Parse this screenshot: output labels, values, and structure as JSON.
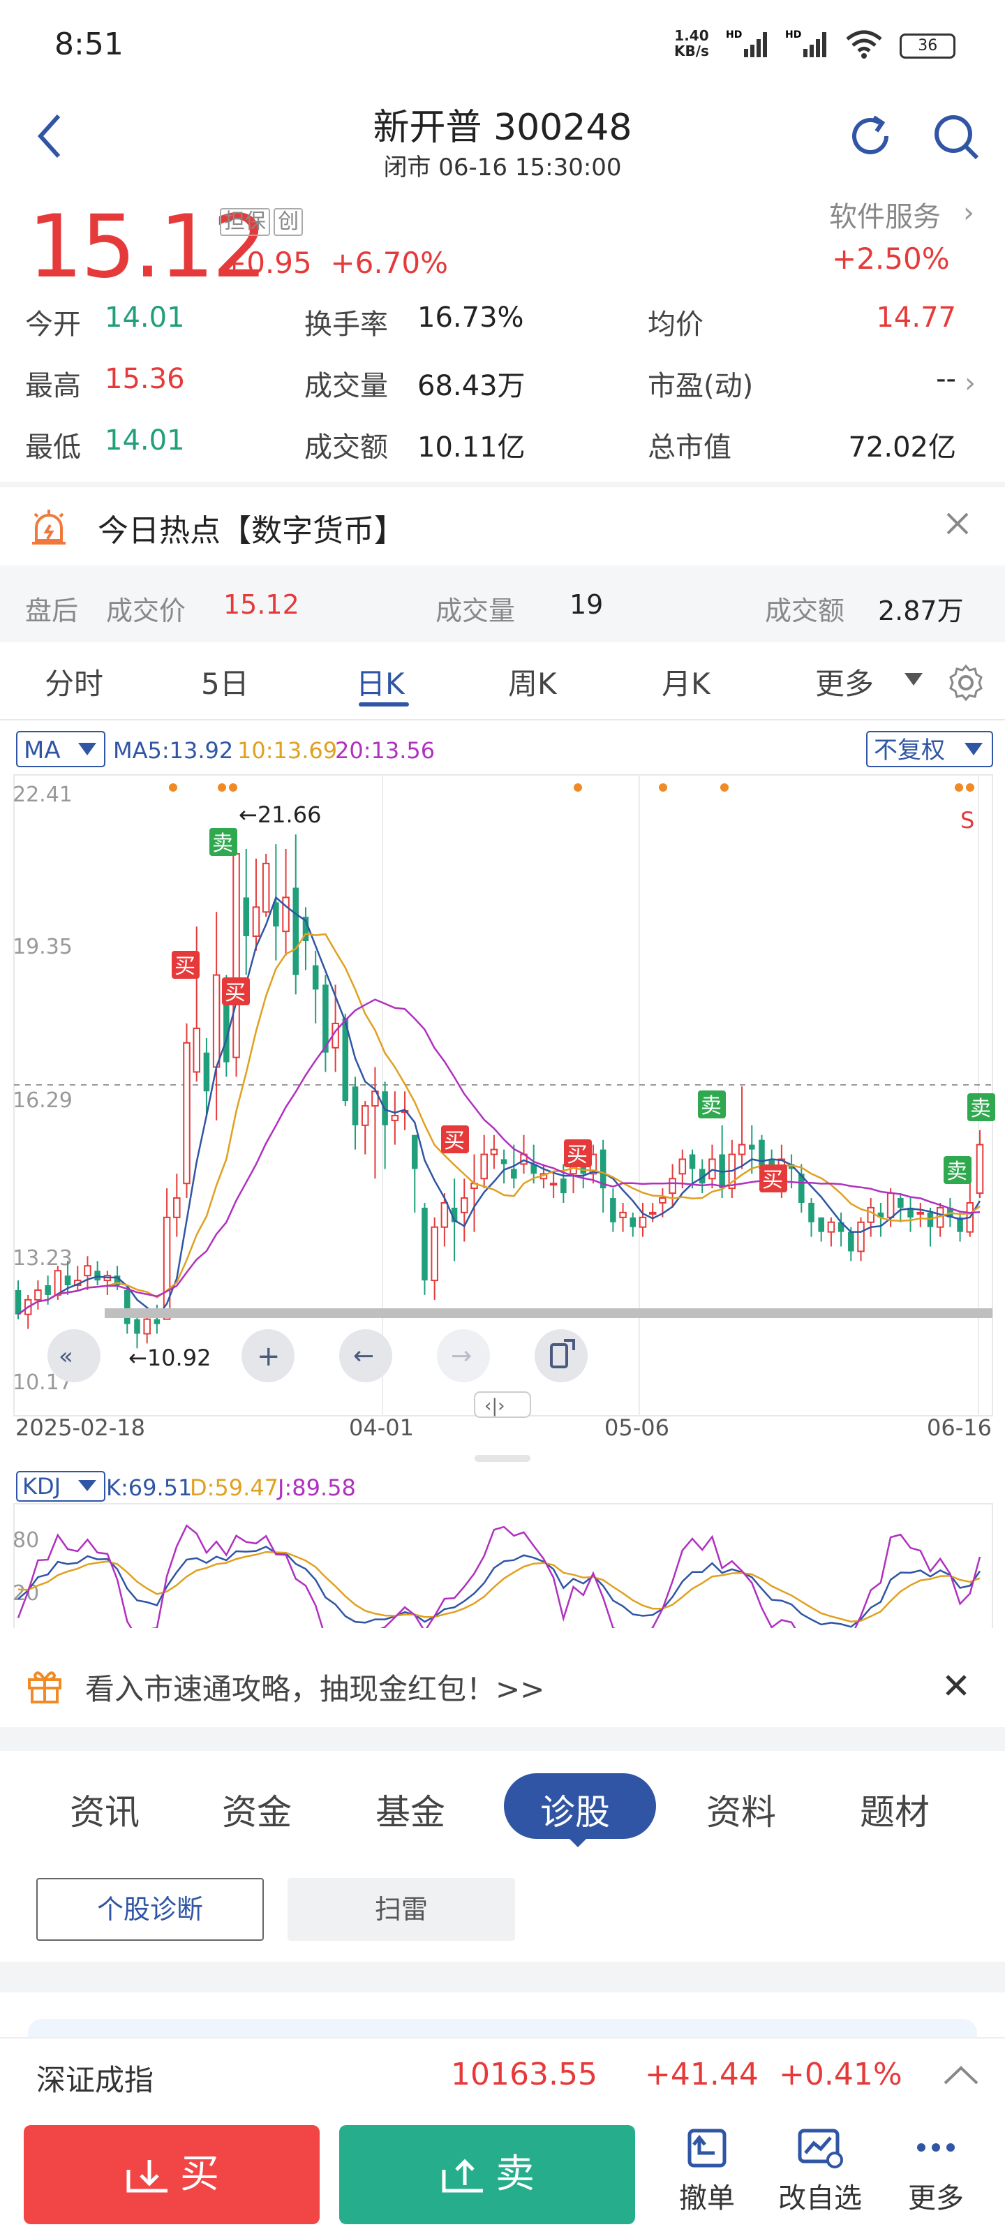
{
  "status_bar": {
    "time": "8:51",
    "speed": "1.40",
    "speed_unit": "KB/s",
    "battery": "36"
  },
  "header": {
    "title": "新开普 300248",
    "market_status": "闭市 06-16 15:30:00"
  },
  "price": {
    "value": "15.12",
    "tags": [
      "担保",
      "创"
    ],
    "change": "+0.95",
    "change_pct": "+6.70%",
    "sector_label": "软件服务",
    "sector_change": "+2.50%"
  },
  "quotes": [
    {
      "label": "今开",
      "value": "14.01",
      "color": "green"
    },
    {
      "label": "换手率",
      "value": "16.73%",
      "color": "black"
    },
    {
      "label": "均价",
      "value": "14.77",
      "color": "red"
    },
    {
      "label": "最高",
      "value": "15.36",
      "color": "red"
    },
    {
      "label": "成交量",
      "value": "68.43万",
      "color": "black"
    },
    {
      "label": "市盈(动)",
      "value": "--",
      "color": "black"
    },
    {
      "label": "最低",
      "value": "14.01",
      "color": "green"
    },
    {
      "label": "成交额",
      "value": "10.11亿",
      "color": "black"
    },
    {
      "label": "总市值",
      "value": "72.02亿",
      "color": "black"
    }
  ],
  "hot_topic": {
    "text": "今日热点【数字货币】"
  },
  "after_hours": {
    "label": "盘后",
    "price_label": "成交价",
    "price": "15.12",
    "volume_label": "成交量",
    "volume": "19",
    "amount_label": "成交额",
    "amount": "2.87万"
  },
  "period_tabs": [
    "分时",
    "5日",
    "日K",
    "周K",
    "月K",
    "更多"
  ],
  "active_period": "日K",
  "kline": {
    "indicator": "MA",
    "ma5": "MA5:13.92",
    "ma10": "10:13.69",
    "ma20": "20:13.56",
    "adjust": "不复权",
    "y_labels": [
      "22.41",
      "19.35",
      "16.29",
      "13.23",
      "10.17"
    ],
    "x_labels": [
      "2025-02-18",
      "04-01",
      "05-06",
      "06-16"
    ],
    "high_mark": "←21.66",
    "low_mark": "←10.92",
    "signal_buy": "买",
    "signal_sell": "卖",
    "s_mark": "S"
  },
  "kdj": {
    "indicator": "KDJ",
    "k": "K:69.51",
    "d": "D:59.47",
    "j": "J:89.58",
    "y_labels": [
      "80",
      "20"
    ]
  },
  "chart_data": {
    "type": "candlestick",
    "y_range": [
      10.17,
      22.41
    ],
    "x_labels": [
      "2025-02-18",
      "04-01",
      "05-06",
      "06-16"
    ],
    "candles": [
      [
        12.1,
        11.6,
        12.3,
        11.5
      ],
      [
        11.6,
        11.9,
        12.0,
        11.3
      ],
      [
        11.9,
        12.1,
        12.3,
        11.7
      ],
      [
        12.2,
        12.0,
        12.4,
        11.8
      ],
      [
        12.0,
        12.5,
        12.6,
        11.9
      ],
      [
        12.4,
        12.2,
        12.7,
        12.0
      ],
      [
        12.2,
        12.3,
        12.6,
        12.1
      ],
      [
        12.4,
        12.6,
        12.8,
        12.1
      ],
      [
        12.5,
        12.3,
        12.7,
        12.2
      ],
      [
        12.3,
        12.4,
        12.5,
        12.0
      ],
      [
        12.4,
        12.2,
        12.6,
        12.1
      ],
      [
        12.1,
        11.4,
        12.2,
        11.2
      ],
      [
        11.5,
        11.2,
        11.7,
        10.9
      ],
      [
        11.2,
        11.5,
        11.7,
        11.0
      ],
      [
        11.5,
        11.4,
        11.8,
        11.2
      ],
      [
        11.5,
        13.6,
        14.2,
        11.5
      ],
      [
        13.6,
        14.0,
        14.5,
        13.2
      ],
      [
        14.3,
        17.2,
        17.6,
        14.0
      ],
      [
        16.6,
        17.5,
        19.6,
        16.4
      ],
      [
        17.0,
        16.2,
        17.3,
        15.7
      ],
      [
        16.7,
        18.6,
        19.9,
        15.6
      ],
      [
        18.1,
        16.8,
        18.6,
        16.5
      ],
      [
        16.9,
        21.1,
        21.6,
        16.5
      ],
      [
        20.2,
        19.4,
        21.2,
        18.6
      ],
      [
        19.4,
        20.0,
        21.0,
        19.1
      ],
      [
        19.9,
        20.9,
        21.1,
        19.8
      ],
      [
        20.1,
        19.6,
        21.3,
        18.9
      ],
      [
        19.5,
        20.2,
        21.2,
        19.0
      ],
      [
        20.4,
        18.6,
        21.5,
        18.2
      ],
      [
        19.8,
        19.3,
        20.0,
        18.7
      ],
      [
        18.8,
        18.3,
        19.1,
        17.6
      ],
      [
        18.4,
        17.0,
        18.6,
        16.6
      ],
      [
        17.1,
        17.6,
        18.4,
        16.6
      ],
      [
        17.7,
        16.0,
        17.8,
        15.9
      ],
      [
        16.3,
        15.5,
        16.5,
        15.0
      ],
      [
        15.5,
        15.9,
        16.0,
        14.9
      ],
      [
        15.9,
        16.2,
        16.7,
        14.4
      ],
      [
        16.2,
        15.5,
        16.4,
        14.6
      ],
      [
        15.6,
        15.7,
        16.2,
        15.1
      ],
      [
        15.8,
        15.8,
        16.2,
        15.4
      ],
      [
        15.3,
        14.6,
        15.3,
        13.7
      ],
      [
        13.8,
        12.3,
        13.9,
        12.0
      ],
      [
        12.3,
        13.4,
        13.6,
        11.9
      ],
      [
        13.4,
        13.9,
        14.1,
        13.0
      ],
      [
        13.8,
        13.5,
        14.4,
        12.7
      ],
      [
        13.7,
        14.0,
        14.4,
        13.1
      ],
      [
        14.2,
        14.3,
        14.9,
        13.3
      ],
      [
        14.4,
        14.9,
        15.3,
        14.2
      ],
      [
        14.9,
        15.0,
        15.3,
        14.6
      ],
      [
        14.8,
        14.7,
        15.0,
        14.3
      ],
      [
        14.6,
        14.4,
        15.1,
        14.2
      ],
      [
        14.7,
        14.9,
        15.3,
        14.5
      ],
      [
        14.7,
        14.5,
        15.1,
        14.3
      ],
      [
        14.4,
        14.5,
        14.7,
        14.2
      ],
      [
        14.3,
        14.3,
        14.5,
        14.0
      ],
      [
        14.4,
        14.1,
        14.7,
        13.9
      ],
      [
        14.5,
        14.9,
        15.1,
        14.1
      ],
      [
        14.9,
        14.5,
        15.1,
        14.2
      ],
      [
        14.5,
        14.9,
        15.1,
        14.3
      ],
      [
        15.0,
        14.2,
        15.2,
        13.7
      ],
      [
        14.0,
        13.5,
        14.2,
        13.3
      ],
      [
        13.6,
        13.7,
        13.9,
        13.3
      ],
      [
        13.6,
        13.4,
        13.7,
        13.2
      ],
      [
        13.4,
        13.6,
        13.9,
        13.2
      ],
      [
        13.7,
        13.7,
        13.9,
        13.5
      ],
      [
        13.9,
        14.0,
        14.2,
        13.6
      ],
      [
        14.1,
        14.4,
        14.7,
        13.8
      ],
      [
        14.5,
        14.8,
        15.0,
        14.2
      ],
      [
        14.9,
        14.6,
        15.0,
        14.2
      ],
      [
        14.6,
        14.3,
        14.8,
        14.1
      ],
      [
        14.4,
        14.8,
        15.1,
        14.2
      ],
      [
        14.9,
        14.2,
        15.5,
        14.0
      ],
      [
        14.2,
        14.9,
        15.2,
        14.0
      ],
      [
        14.9,
        15.1,
        16.3,
        14.6
      ],
      [
        15.1,
        15.0,
        15.5,
        14.5
      ],
      [
        15.2,
        14.6,
        15.3,
        14.3
      ],
      [
        14.8,
        14.4,
        15.0,
        14.2
      ],
      [
        14.3,
        14.8,
        15.1,
        14.0
      ],
      [
        14.7,
        14.6,
        14.9,
        14.2
      ],
      [
        14.5,
        13.9,
        14.7,
        13.7
      ],
      [
        13.9,
        13.5,
        14.0,
        13.2
      ],
      [
        13.6,
        13.3,
        13.6,
        13.1
      ],
      [
        13.3,
        13.5,
        13.6,
        13.0
      ],
      [
        13.5,
        13.3,
        13.7,
        13.0
      ],
      [
        13.3,
        12.9,
        13.4,
        12.7
      ],
      [
        12.9,
        13.5,
        13.6,
        12.7
      ],
      [
        13.5,
        13.8,
        14.0,
        13.2
      ],
      [
        13.7,
        13.6,
        13.9,
        13.2
      ],
      [
        13.6,
        14.1,
        14.2,
        13.4
      ],
      [
        14.0,
        13.8,
        14.1,
        13.5
      ],
      [
        13.8,
        13.6,
        14.0,
        13.3
      ],
      [
        13.7,
        13.7,
        13.9,
        13.4
      ],
      [
        13.7,
        13.4,
        13.8,
        13.0
      ],
      [
        13.4,
        13.8,
        13.9,
        13.2
      ],
      [
        13.8,
        13.6,
        14.0,
        13.4
      ],
      [
        13.6,
        13.3,
        13.7,
        13.1
      ],
      [
        13.3,
        13.9,
        14.7,
        13.2
      ],
      [
        14.1,
        15.1,
        15.4,
        14.0
      ]
    ],
    "ma5_last": 13.92,
    "ma10_last": 13.69,
    "ma20_last": 13.56,
    "kdj_last": {
      "K": 69.51,
      "D": 59.47,
      "J": 89.58
    }
  },
  "ad": {
    "text": "看入市速通攻略，抽现金红包！>>"
  },
  "bottom_tabs": [
    "资讯",
    "资金",
    "基金",
    "诊股",
    "资料",
    "题材"
  ],
  "active_bottom_tab": "诊股",
  "sub_buttons": {
    "diagnosis": "个股诊断",
    "scan": "扫雷"
  },
  "index": {
    "name": "深证成指",
    "value": "10163.55",
    "change": "+41.44",
    "pct": "+0.41%"
  },
  "actions": {
    "buy": "买",
    "sell": "卖",
    "cancel": "撤单",
    "edit_watch": "改自选",
    "more": "更多"
  },
  "colors": {
    "up": "#e63a3a",
    "down": "#1f9f7a",
    "accent": "#2f55a4",
    "buy": "#f24545",
    "sell": "#26ae8c"
  }
}
